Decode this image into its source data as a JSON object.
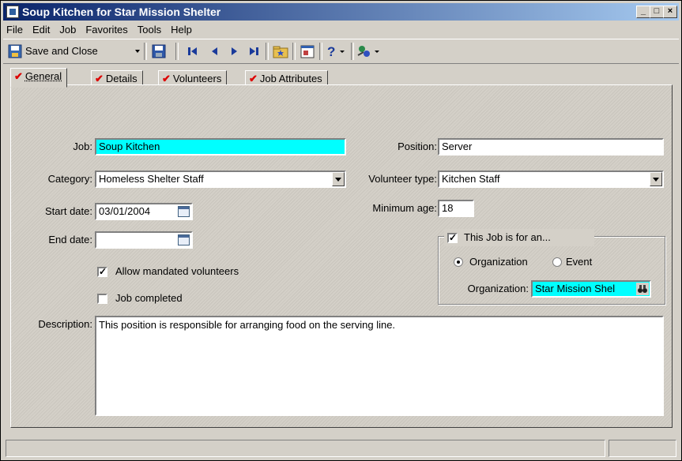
{
  "window": {
    "title": "Soup Kitchen for Star Mission Shelter"
  },
  "menu": [
    "File",
    "Edit",
    "Job",
    "Favorites",
    "Tools",
    "Help"
  ],
  "toolbar": {
    "save_close": "Save and Close"
  },
  "tabs": [
    {
      "label": "General"
    },
    {
      "label": "Details"
    },
    {
      "label": "Volunteers"
    },
    {
      "label": "Job Attributes"
    }
  ],
  "form": {
    "job_label": "Job:",
    "job_value": "Soup Kitchen",
    "category_label": "Category:",
    "category_value": "Homeless Shelter Staff",
    "start_label": "Start date:",
    "start_value": "03/01/2004",
    "end_label": "End date:",
    "end_value": "",
    "position_label": "Position:",
    "position_value": "Server",
    "voltype_label": "Volunteer type:",
    "voltype_value": "Kitchen Staff",
    "minage_label": "Minimum age:",
    "minage_value": "18",
    "allow_mandated": "Allow mandated volunteers",
    "job_completed": "Job completed",
    "group_title": "This Job is for an...",
    "radio_org": "Organization",
    "radio_event": "Event",
    "org_label": "Organization:",
    "org_value": "Star Mission Shel",
    "desc_label": "Description:",
    "desc_value": "This position is responsible for arranging food on the serving line."
  },
  "state": {
    "allow_mandated_checked": true,
    "job_completed_checked": false,
    "job_for_checked": true,
    "selected_radio": "Organization"
  },
  "colors": {
    "required_field": "#00ffff",
    "titlebar_start": "#0a246a",
    "titlebar_end": "#a6caf0",
    "tab_check": "#dd0000"
  }
}
